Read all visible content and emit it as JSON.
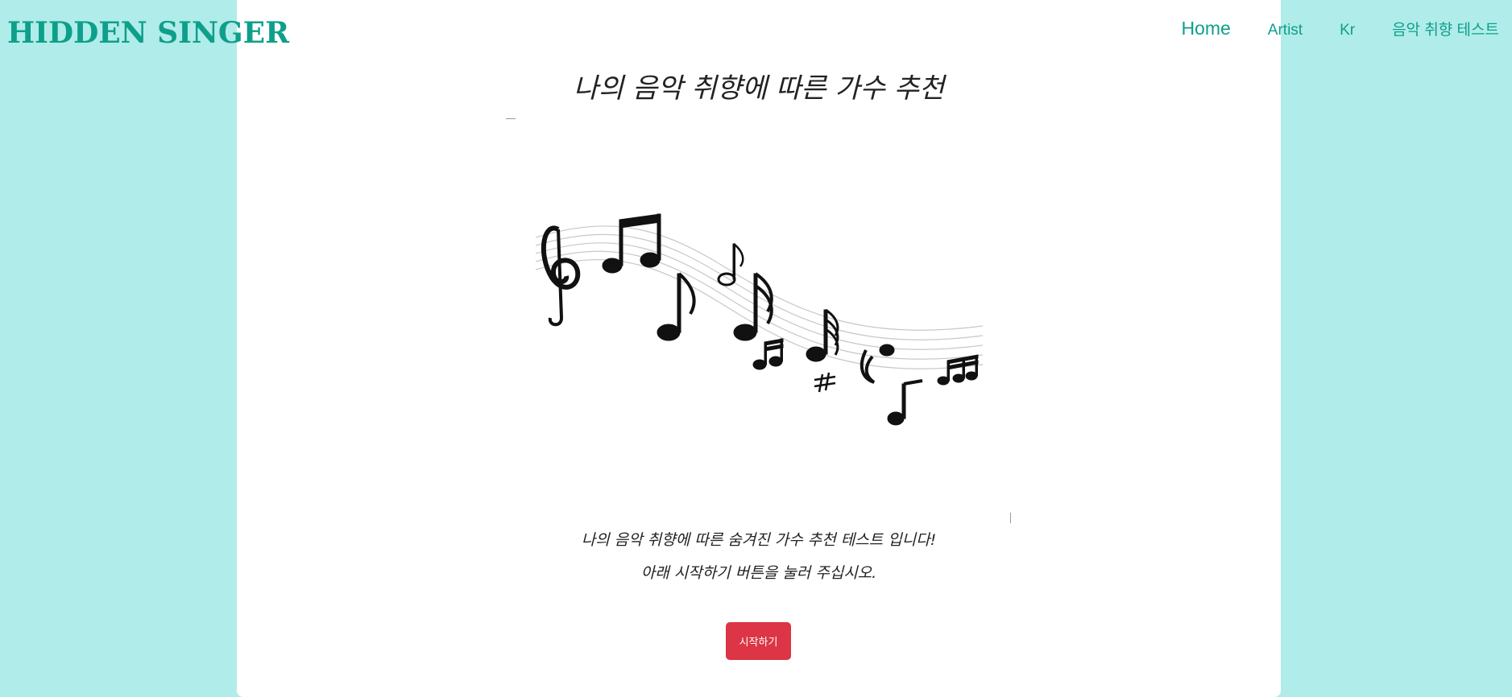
{
  "header": {
    "logo": "HIDDEN SINGER",
    "nav": {
      "home": "Home",
      "artist": "Artist",
      "kr": "Kr",
      "music_test": "음악 취향 테스트"
    }
  },
  "main": {
    "title": "나의 음악 취향에 따른 가수 추천",
    "image_icon": "music-notes-staff-icon",
    "description_line1": "나의 음악 취향에 따른 숨겨진 가수 추천 테스트 입니다!",
    "description_line2": "아래 시작하기 버튼을 눌러 주십시오.",
    "start_button": "시작하기"
  },
  "colors": {
    "background": "#b0ecea",
    "panel": "#ffffff",
    "brand": "#0e9f8a",
    "button": "#dc3545"
  }
}
